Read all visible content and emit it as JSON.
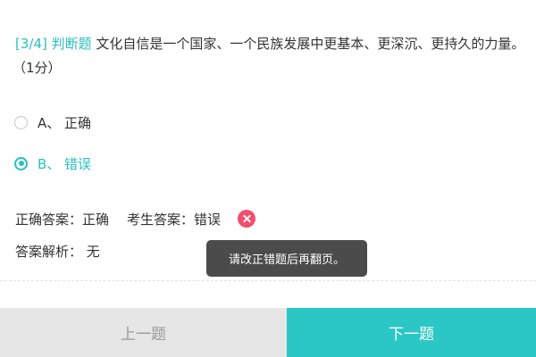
{
  "question": {
    "tag": "[3/4] 判断题",
    "text": "文化自信是一个国家、一个民族发展中更基本、更深沉、更持久的力量。",
    "score": "（1分）"
  },
  "options": [
    {
      "label": "A、 正确",
      "selected": false
    },
    {
      "label": "B、 错误",
      "selected": true
    }
  ],
  "result": {
    "correct_answer_label": "正确答案：",
    "correct_answer_value": "正确",
    "user_answer_label": "考生答案：",
    "user_answer_value": "错误",
    "status_icon": "wrong-icon"
  },
  "analysis": {
    "label": "答案解析：",
    "value": "无"
  },
  "toast": {
    "message": "请改正错题后再翻页。"
  },
  "footer": {
    "prev_label": "上一题",
    "next_label": "下一题"
  },
  "colors": {
    "accent": "#2bbfc0",
    "next_button": "#2bc7c4",
    "wrong": "#f0506e",
    "toast_bg": "#4b4b4b"
  }
}
